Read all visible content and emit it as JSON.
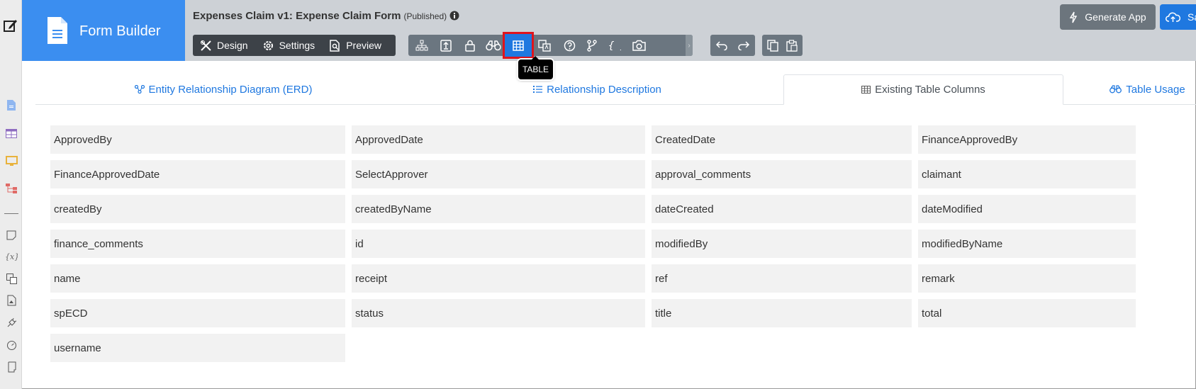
{
  "header": {
    "brand_title": "Form Builder",
    "form_title": "Expenses Claim v1: Expense Claim Form",
    "status": "(Published)"
  },
  "modes": [
    {
      "label": "Design",
      "icon": "design-tools-icon"
    },
    {
      "label": "Settings",
      "icon": "gear-icon"
    },
    {
      "label": "Preview",
      "icon": "preview-icon"
    }
  ],
  "toolbar": {
    "icons": [
      "sitemap-icon",
      "upload-doc-icon",
      "lock-icon",
      "binoculars-icon",
      "table-icon",
      "translate-icon",
      "help-circle-icon",
      "branch-icon",
      "braces-icon",
      "camera-icon"
    ],
    "active": "table-icon",
    "tooltip": "TABLE",
    "undo_redo": [
      "undo-icon",
      "redo-icon"
    ],
    "clipboard": [
      "copy-icon",
      "paste-icon"
    ]
  },
  "actions": {
    "generate_label": "Generate App",
    "save_label": "Save"
  },
  "tabs": [
    {
      "label": "Entity Relationship Diagram (ERD)",
      "icon": "erd-icon"
    },
    {
      "label": "Relationship Description",
      "icon": "list-icon"
    },
    {
      "label": "Existing Table Columns",
      "icon": "table-icon"
    },
    {
      "label": "Table Usage",
      "icon": "binoculars-icon"
    }
  ],
  "active_tab": "Existing Table Columns",
  "columns": [
    [
      "ApprovedBy",
      "ApprovedDate",
      "CreatedDate",
      "FinanceApprovedBy"
    ],
    [
      "FinanceApprovedDate",
      "SelectApprover",
      "approval_comments",
      "claimant"
    ],
    [
      "createdBy",
      "createdByName",
      "dateCreated",
      "dateModified"
    ],
    [
      "finance_comments",
      "id",
      "modifiedBy",
      "modifiedByName"
    ],
    [
      "name",
      "receipt",
      "ref",
      "remark"
    ],
    [
      "spECD",
      "status",
      "title",
      "total"
    ],
    [
      "username"
    ]
  ],
  "rail_icons": [
    "edit-icon",
    "document-icon",
    "table-grid-icon",
    "monitor-icon",
    "hierarchy-icon",
    "note-icon",
    "variable-icon",
    "translate-icon",
    "file-image-icon",
    "plug-icon",
    "gauge-icon",
    "scroll-icon"
  ],
  "colors": {
    "brand_blue": "#3b8ef0",
    "active_highlight": "#e0141c",
    "header_bg": "#cdd1d6",
    "cell_bg": "#f2f2f2"
  }
}
